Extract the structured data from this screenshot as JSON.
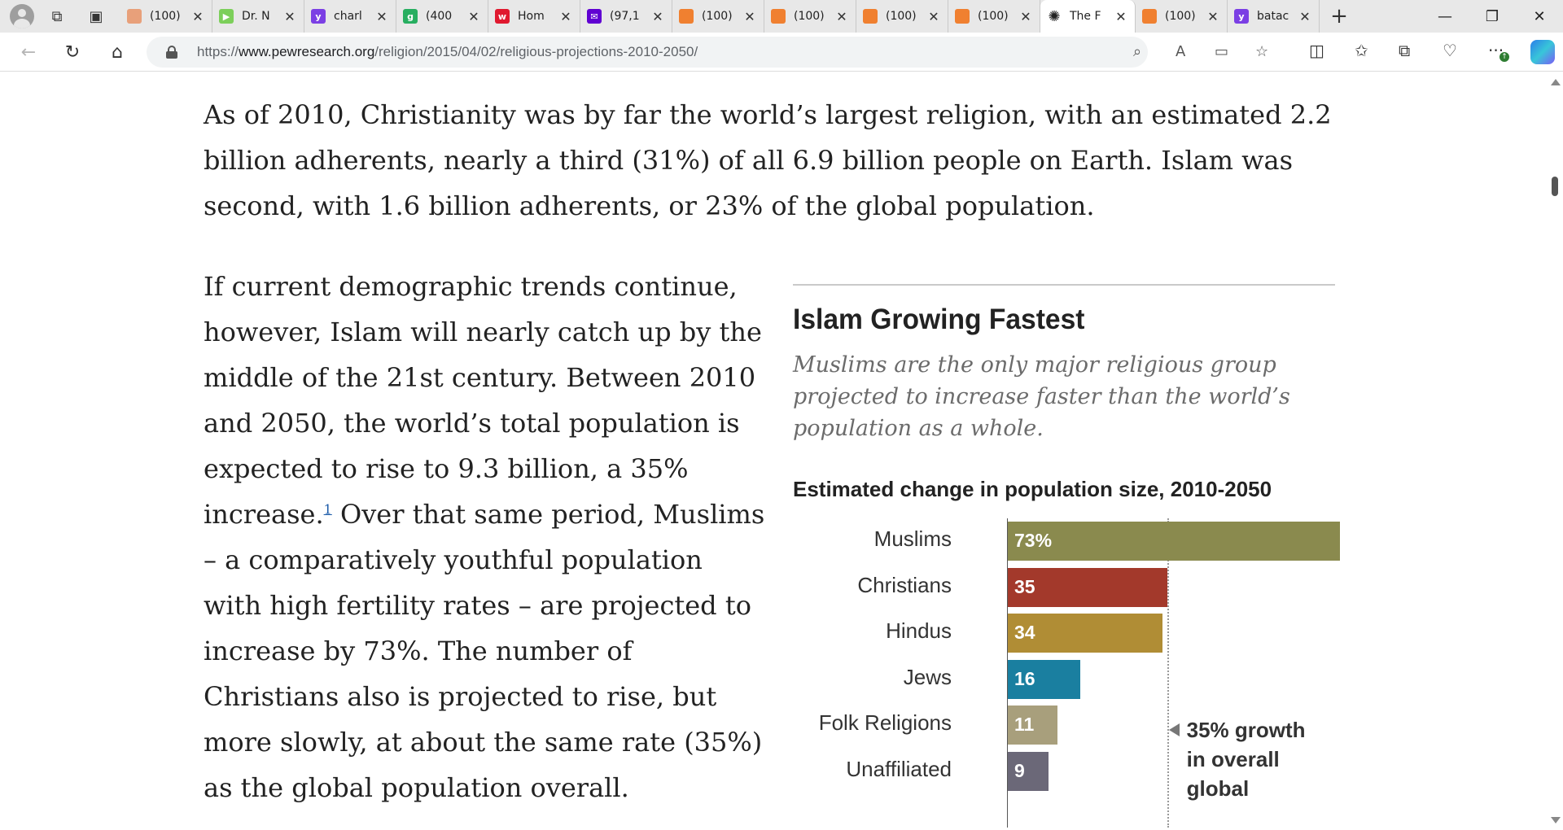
{
  "browser": {
    "tabs": [
      {
        "title": "(100)",
        "favicon": "bookmark-icon",
        "color": "#e8a07a"
      },
      {
        "title": "Dr. N",
        "favicon": "play-icon",
        "color": "#7ccf5a"
      },
      {
        "title": "charl",
        "favicon": "yahoo-icon",
        "color": "#7b3fe4"
      },
      {
        "title": "(400",
        "favicon": "g-icon",
        "color": "#27ae60"
      },
      {
        "title": "Hom",
        "favicon": "wattpad-icon",
        "color": "#e0192f"
      },
      {
        "title": "(97,1",
        "favicon": "yahoo-mail-icon",
        "color": "#6001d2"
      },
      {
        "title": "(100)",
        "favicon": "bookmark-icon",
        "color": "#f08030"
      },
      {
        "title": "(100)",
        "favicon": "bookmark-icon",
        "color": "#f08030"
      },
      {
        "title": "(100)",
        "favicon": "bookmark-icon",
        "color": "#f08030"
      },
      {
        "title": "(100)",
        "favicon": "bookmark-icon",
        "color": "#f08030"
      },
      {
        "title": "The F",
        "favicon": "pew-icon",
        "color": "#222222",
        "active": true
      },
      {
        "title": "(100)",
        "favicon": "bookmark-icon",
        "color": "#f08030"
      },
      {
        "title": "batac",
        "favicon": "yahoo-icon",
        "color": "#7b3fe4"
      }
    ],
    "url_scheme": "https://",
    "url_domain": "www.pewresearch.org",
    "url_path": "/religion/2015/04/02/religious-projections-2010-2050/"
  },
  "article": {
    "paragraph1": "As of 2010, Christianity was by far the world’s largest religion, with an estimated 2.2 billion adherents, nearly a third (31%) of all 6.9 billion people on Earth. Islam was second, with 1.6 billion adherents, or 23% of the global population.",
    "paragraph2_before": "If current demographic trends continue, however, Islam will nearly catch up by the middle of the 21st century. Between 2010 and 2050, the world’s total population is expected to rise to 9.3 billion, a 35% increase.",
    "footnote": "1",
    "paragraph2_after": " Over that same period, Muslims – a comparatively youthful population with high fertility rates – are projected to increase by 73%. The number of Christians also is projected to rise, but more slowly, at about the same rate (35%) as the global population overall."
  },
  "chart_data": {
    "type": "bar",
    "title": "Islam Growing Fastest",
    "subtitle": "Muslims are the only major religious group projected to increase faster than the world’s population as a whole.",
    "axis_title": "Estimated change in population size, 2010-2050",
    "categories": [
      "Muslims",
      "Christians",
      "Hindus",
      "Jews",
      "Folk Religions",
      "Unaffiliated"
    ],
    "values": [
      73,
      35,
      34,
      16,
      11,
      9
    ],
    "value_labels": [
      "73%",
      "35",
      "34",
      "16",
      "11",
      "9"
    ],
    "colors": [
      "#8a8a4e",
      "#a3392b",
      "#b08d35",
      "#1a7fa0",
      "#a89f7c",
      "#6b6878"
    ],
    "reference_value": 35,
    "annotation": "35% growth\nin overall\nglobal",
    "xlim": [
      0,
      73
    ]
  }
}
